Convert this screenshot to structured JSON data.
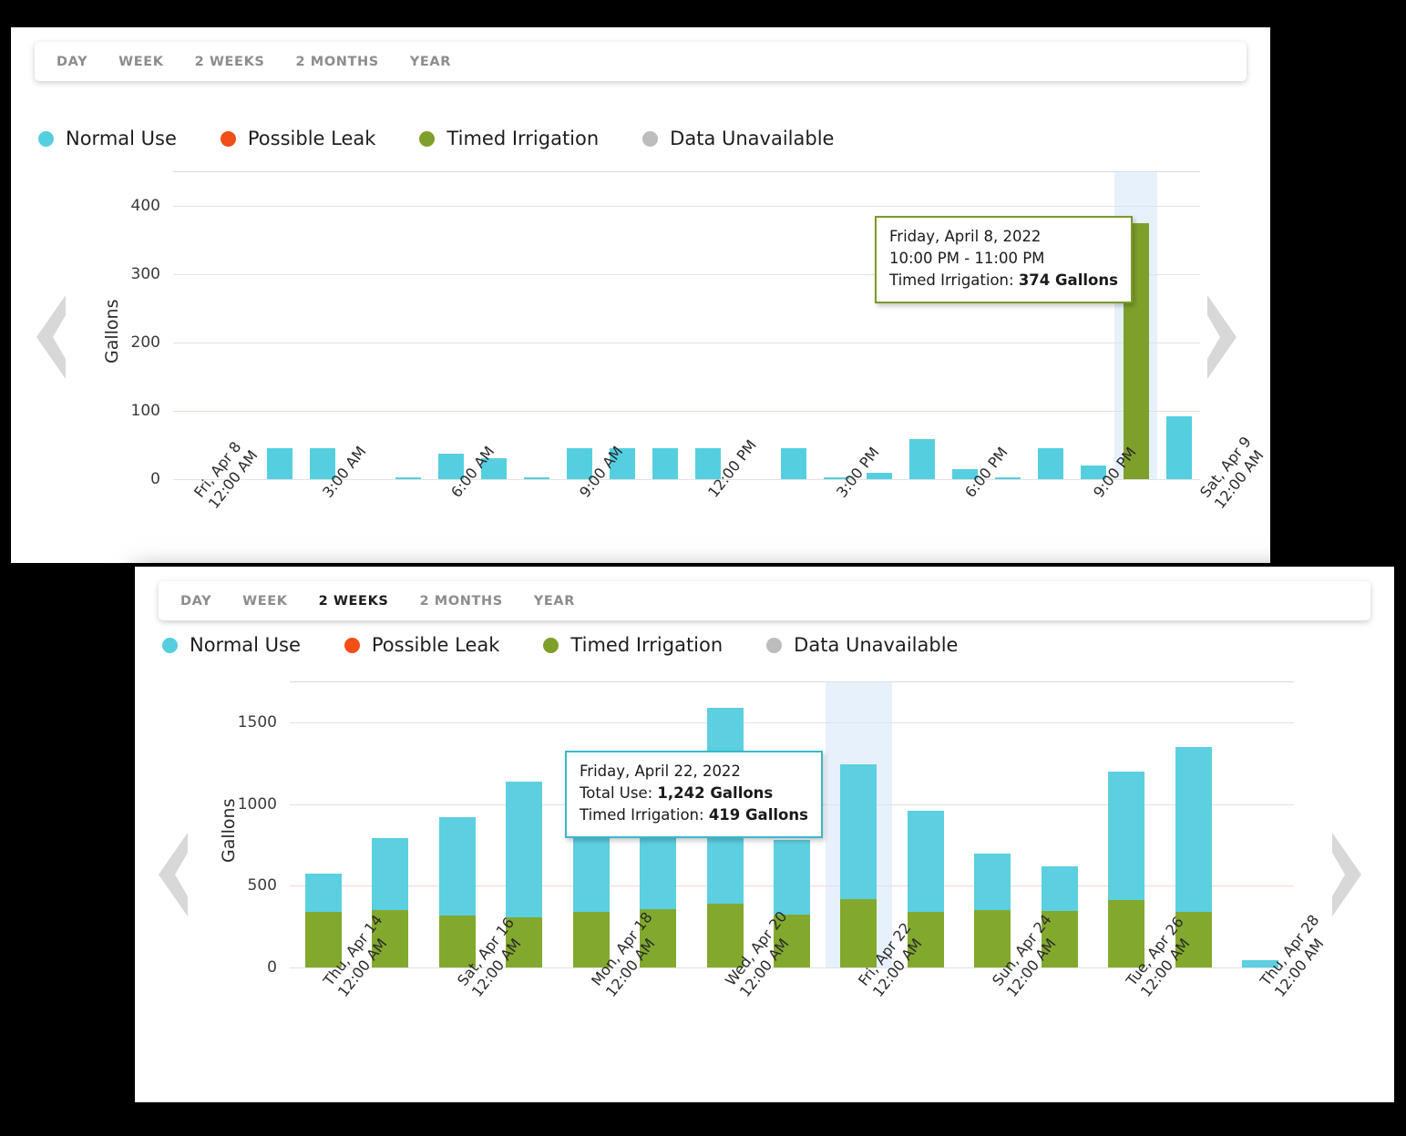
{
  "charts": [
    {
      "id": "day",
      "tabs": [
        {
          "label": "DAY",
          "active": false
        },
        {
          "label": "WEEK",
          "active": false
        },
        {
          "label": "2 WEEKS",
          "active": false
        },
        {
          "label": "2 MONTHS",
          "active": false
        },
        {
          "label": "YEAR",
          "active": false
        }
      ],
      "legend": [
        {
          "label": "Normal Use",
          "color": "#55cfe0"
        },
        {
          "label": "Possible Leak",
          "color": "#f24e17"
        },
        {
          "label": "Timed Irrigation",
          "color": "#7f9f2b"
        },
        {
          "label": "Data Unavailable",
          "color": "#bdbdbd"
        }
      ],
      "tooltip": {
        "line1": "Friday, April 8, 2022",
        "line2": "10:00 PM - 11:00 PM",
        "line3_label": "Timed Irrigation: ",
        "line3_value": "374 Gallons"
      },
      "nav": {
        "prev": "previous-period",
        "next": "next-period"
      },
      "chart_data": {
        "type": "bar",
        "title": "",
        "xlabel": "",
        "ylabel": "Gallons",
        "ylim": [
          0,
          450
        ],
        "yticks": [
          0,
          100,
          200,
          300,
          400
        ],
        "grid": true,
        "legend_position": "top-left",
        "x": [
          "Fri, Apr 8\n12:00 AM",
          "1:00 AM",
          "2:00 AM",
          "3:00 AM",
          "4:00 AM",
          "5:00 AM",
          "6:00 AM",
          "7:00 AM",
          "8:00 AM",
          "9:00 AM",
          "10:00 AM",
          "11:00 AM",
          "12:00 PM",
          "1:00 PM",
          "2:00 PM",
          "3:00 PM",
          "4:00 PM",
          "5:00 PM",
          "6:00 PM",
          "7:00 PM",
          "8:00 PM",
          "9:00 PM",
          "10:00 PM",
          "11:00 PM"
        ],
        "tick_labels": [
          {
            "index": 0,
            "text": "Fri, Apr 8\n12:00 AM"
          },
          {
            "index": 3,
            "text": "3:00 AM"
          },
          {
            "index": 6,
            "text": "6:00 AM"
          },
          {
            "index": 9,
            "text": "9:00 AM"
          },
          {
            "index": 12,
            "text": "12:00 PM"
          },
          {
            "index": 15,
            "text": "3:00 PM"
          },
          {
            "index": 18,
            "text": "6:00 PM"
          },
          {
            "index": 21,
            "text": "9:00 PM"
          },
          {
            "index": 24,
            "text": "Sat, Apr 9\n12:00 AM"
          }
        ],
        "series": [
          {
            "name": "Normal Use",
            "color": "#55cfe0",
            "values": [
              0,
              0,
              45,
              45,
              0,
              3,
              37,
              30,
              3,
              45,
              45,
              45,
              45,
              0,
              45,
              2,
              9,
              58,
              14,
              3,
              45,
              20,
              0,
              92
            ]
          },
          {
            "name": "Timed Irrigation",
            "color": "#7f9f2b",
            "values": [
              0,
              0,
              0,
              0,
              0,
              0,
              0,
              0,
              0,
              0,
              0,
              0,
              0,
              0,
              0,
              0,
              0,
              0,
              0,
              0,
              0,
              0,
              374,
              0
            ]
          }
        ],
        "highlighted_index": 22,
        "highlight_label": "10:00 PM"
      }
    },
    {
      "id": "twoweeks",
      "tabs": [
        {
          "label": "DAY",
          "active": false
        },
        {
          "label": "WEEK",
          "active": false
        },
        {
          "label": "2 WEEKS",
          "active": true
        },
        {
          "label": "2 MONTHS",
          "active": false
        },
        {
          "label": "YEAR",
          "active": false
        }
      ],
      "legend": [
        {
          "label": "Normal Use",
          "color": "#55cfe0"
        },
        {
          "label": "Possible Leak",
          "color": "#f24e17"
        },
        {
          "label": "Timed Irrigation",
          "color": "#7f9f2b"
        },
        {
          "label": "Data Unavailable",
          "color": "#bdbdbd"
        }
      ],
      "tooltip": {
        "line1": "Friday, April 22, 2022",
        "line2_label": "Total Use: ",
        "line2_value": "1,242 Gallons",
        "line3_label": "Timed Irrigation: ",
        "line3_value": "419 Gallons"
      },
      "nav": {
        "prev": "previous-period",
        "next": "next-period"
      },
      "chart_data": {
        "type": "bar",
        "stacked": true,
        "title": "",
        "xlabel": "",
        "ylabel": "Gallons",
        "ylim": [
          0,
          1750
        ],
        "yticks": [
          0,
          500,
          1000,
          1500
        ],
        "grid": true,
        "legend_position": "top-left",
        "x": [
          "Thu, Apr 14\n12:00 AM",
          "Fri, Apr 15\n12:00 AM",
          "Sat, Apr 16\n12:00 AM",
          "Sun, Apr 17\n12:00 AM",
          "Mon, Apr 18\n12:00 AM",
          "Tue, Apr 19\n12:00 AM",
          "Wed, Apr 20\n12:00 AM",
          "Thu, Apr 21\n12:00 AM",
          "Fri, Apr 22\n12:00 AM",
          "Sat, Apr 23\n12:00 AM",
          "Sun, Apr 24\n12:00 AM",
          "Mon, Apr 25\n12:00 AM",
          "Tue, Apr 26\n12:00 AM",
          "Wed, Apr 27\n12:00 AM",
          "Thu, Apr 28\n12:00 AM"
        ],
        "tick_labels": [
          {
            "index": 0,
            "text": "Thu, Apr 14\n12:00 AM"
          },
          {
            "index": 2,
            "text": "Sat, Apr 16\n12:00 AM"
          },
          {
            "index": 4,
            "text": "Mon, Apr 18\n12:00 AM"
          },
          {
            "index": 6,
            "text": "Wed, Apr 20\n12:00 AM"
          },
          {
            "index": 8,
            "text": "Fri, Apr 22\n12:00 AM"
          },
          {
            "index": 10,
            "text": "Sun, Apr 24\n12:00 AM"
          },
          {
            "index": 12,
            "text": "Tue, Apr 26\n12:00 AM"
          },
          {
            "index": 14,
            "text": "Thu, Apr 28\n12:00 AM"
          }
        ],
        "series": [
          {
            "name": "Timed Irrigation",
            "color": "#83a82e",
            "values": [
              340,
              350,
              320,
              305,
              340,
              355,
              390,
              325,
              419,
              340,
              350,
              348,
              415,
              340,
              0
            ]
          },
          {
            "name": "Normal Use",
            "color": "#5ccfe0",
            "values": [
              235,
              440,
              600,
              830,
              625,
              620,
              1200,
              455,
              823,
              620,
              345,
              268,
              785,
              1010,
              45
            ]
          }
        ],
        "totals": [
          575,
          790,
          920,
          1135,
          965,
          975,
          1590,
          780,
          1242,
          960,
          695,
          616,
          1200,
          1350,
          45
        ],
        "highlighted_index": 8,
        "highlight_label": "Fri, Apr 22"
      }
    }
  ]
}
